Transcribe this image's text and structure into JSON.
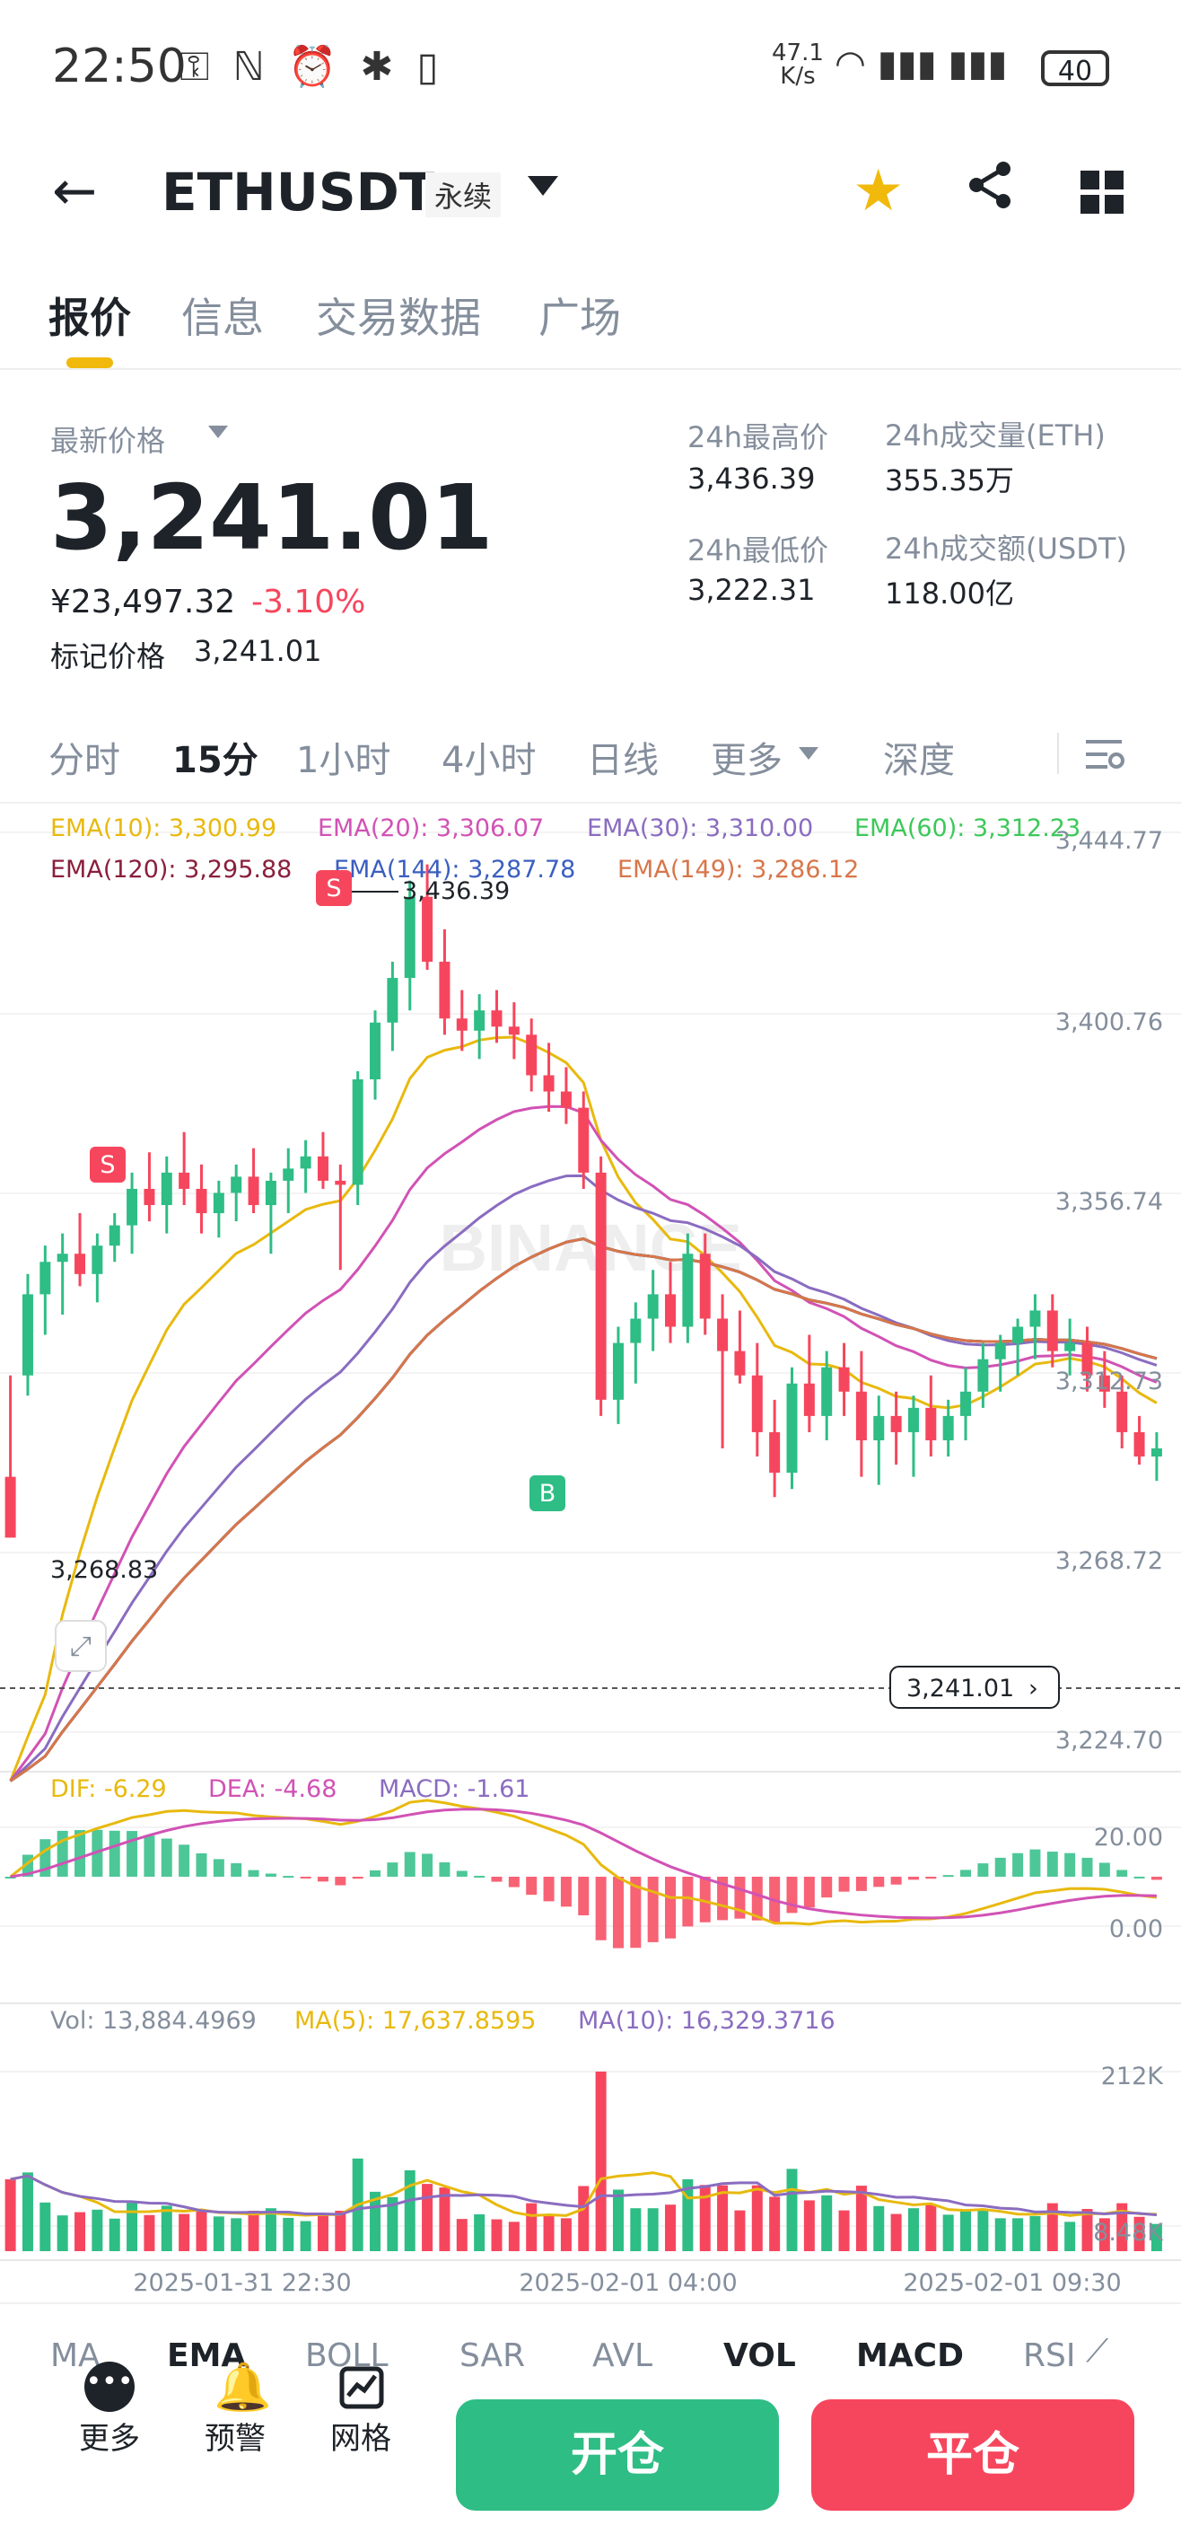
{
  "status_bar": {
    "time": "22:50",
    "icons_left": "⚿ ℕ ⏰ ✱ ▯",
    "net_rate_value": "47.1",
    "net_rate_unit": "K/s",
    "icons_right": "◠ ▮▮▮ ▮▮▮",
    "battery": "40"
  },
  "header": {
    "pair": "ETHUSDT",
    "contract_type": "永续"
  },
  "tabs": [
    "报价",
    "信息",
    "交易数据",
    "广场"
  ],
  "price": {
    "latest_label": "最新价格",
    "latest": "3,241.01",
    "cny": "¥23,497.32",
    "change": "-3.10%",
    "mark_label": "标记价格",
    "mark": "3,241.01"
  },
  "stats": {
    "high_label": "24h最高价",
    "high": "3,436.39",
    "low_label": "24h最低价",
    "low": "3,222.31",
    "vol_eth_label": "24h成交量(ETH)",
    "vol_eth": "355.35万",
    "vol_usdt_label": "24h成交额(USDT)",
    "vol_usdt": "118.00亿"
  },
  "intervals": [
    "分时",
    "15分",
    "1小时",
    "4小时",
    "日线",
    "更多",
    "深度"
  ],
  "ema_legend": {
    "ema10": "EMA(10): 3,300.99",
    "ema20": "EMA(20): 3,306.07",
    "ema30": "EMA(30): 3,310.00",
    "ema60": "EMA(60): 3,312.23",
    "ema120": "EMA(120): 3,295.88",
    "ema144": "EMA(144): 3,287.78",
    "ema149": "EMA(149): 3,286.12"
  },
  "price_axis": [
    "3,444.77",
    "3,400.76",
    "3,356.74",
    "3,312.73",
    "3,268.72",
    "3,224.70"
  ],
  "annotations": {
    "high_marker": "3,436.39",
    "low_marker": "3,268.83",
    "current_price_tag": "3,241.01",
    "sell_badge": "S",
    "buy_badge": "B"
  },
  "watermark": "BINANCE",
  "macd_legend": {
    "dif": "DIF: -6.29",
    "dea": "DEA: -4.68",
    "macd": "MACD: -1.61"
  },
  "macd_axis": [
    "20.00",
    "0.00"
  ],
  "vol_legend": {
    "vol": "Vol: 13,884.4969",
    "ma5": "MA(5): 17,637.8595",
    "ma10": "MA(10): 16,329.3716"
  },
  "vol_axis": [
    "212K",
    "8.48K"
  ],
  "time_axis": [
    "2025-01-31 22:30",
    "2025-02-01 04:00",
    "2025-02-01 09:30"
  ],
  "indicators": [
    "MA",
    "EMA",
    "BOLL",
    "SAR",
    "AVL",
    "VOL",
    "MACD",
    "RSI"
  ],
  "toolbar": {
    "more": "更多",
    "alert": "预警",
    "grid": "网格",
    "open": "开仓",
    "close": "平仓"
  },
  "colors": {
    "up": "#2ebd85",
    "down": "#f6465d",
    "accent": "#f0b90b",
    "ema10": "#e8b90e",
    "ema20": "#d152b5",
    "ema30": "#8a6cc0",
    "ema60": "#3cc85a",
    "ema120": "#8a1f3c",
    "ema144": "#3b5fc0",
    "ema149": "#d8764a"
  },
  "chart_data": {
    "type": "candlestick",
    "price_axis": {
      "min": 3224.7,
      "max": 3444.77,
      "ticks": [
        3444.77,
        3400.76,
        3356.74,
        3312.73,
        3268.72,
        3224.7
      ]
    },
    "candles": [
      [
        3285,
        3310,
        3278,
        3270
      ],
      [
        3310,
        3335,
        3305,
        3330
      ],
      [
        3330,
        3342,
        3320,
        3338
      ],
      [
        3338,
        3345,
        3325,
        3340
      ],
      [
        3340,
        3350,
        3332,
        3335
      ],
      [
        3335,
        3345,
        3328,
        3342
      ],
      [
        3342,
        3350,
        3338,
        3347
      ],
      [
        3347,
        3360,
        3340,
        3356
      ],
      [
        3356,
        3365,
        3348,
        3352
      ],
      [
        3352,
        3364,
        3345,
        3360
      ],
      [
        3360,
        3370,
        3352,
        3356
      ],
      [
        3356,
        3362,
        3345,
        3350
      ],
      [
        3350,
        3358,
        3344,
        3355
      ],
      [
        3355,
        3362,
        3348,
        3359
      ],
      [
        3359,
        3366,
        3350,
        3352
      ],
      [
        3352,
        3360,
        3340,
        3358
      ],
      [
        3358,
        3366,
        3350,
        3361
      ],
      [
        3361,
        3368,
        3355,
        3364
      ],
      [
        3364,
        3370,
        3356,
        3358
      ],
      [
        3358,
        3362,
        3336,
        3357
      ],
      [
        3357,
        3385,
        3352,
        3383
      ],
      [
        3383,
        3400,
        3378,
        3397
      ],
      [
        3397,
        3412,
        3390,
        3408
      ],
      [
        3408,
        3432,
        3400,
        3428
      ],
      [
        3428,
        3436,
        3410,
        3412
      ],
      [
        3412,
        3420,
        3394,
        3398
      ],
      [
        3398,
        3405,
        3390,
        3395
      ],
      [
        3395,
        3404,
        3388,
        3400
      ],
      [
        3400,
        3405,
        3392,
        3396
      ],
      [
        3396,
        3402,
        3388,
        3394
      ],
      [
        3394,
        3398,
        3380,
        3384
      ],
      [
        3384,
        3392,
        3375,
        3380
      ],
      [
        3380,
        3386,
        3372,
        3376
      ],
      [
        3376,
        3380,
        3356,
        3360
      ],
      [
        3360,
        3364,
        3300,
        3304
      ],
      [
        3304,
        3322,
        3298,
        3318
      ],
      [
        3318,
        3328,
        3308,
        3324
      ],
      [
        3324,
        3336,
        3316,
        3330
      ],
      [
        3330,
        3338,
        3318,
        3322
      ],
      [
        3322,
        3345,
        3318,
        3340
      ],
      [
        3340,
        3345,
        3320,
        3324
      ],
      [
        3324,
        3330,
        3292,
        3316
      ],
      [
        3316,
        3326,
        3308,
        3310
      ],
      [
        3310,
        3318,
        3290,
        3296
      ],
      [
        3296,
        3304,
        3280,
        3286
      ],
      [
        3286,
        3312,
        3282,
        3308
      ],
      [
        3308,
        3320,
        3296,
        3300
      ],
      [
        3300,
        3316,
        3294,
        3312
      ],
      [
        3312,
        3318,
        3300,
        3306
      ],
      [
        3306,
        3316,
        3285,
        3294
      ],
      [
        3294,
        3305,
        3283,
        3300
      ],
      [
        3300,
        3306,
        3288,
        3296
      ],
      [
        3296,
        3305,
        3285,
        3302
      ],
      [
        3302,
        3310,
        3290,
        3294
      ],
      [
        3294,
        3304,
        3290,
        3300
      ],
      [
        3300,
        3312,
        3294,
        3306
      ],
      [
        3306,
        3318,
        3302,
        3314
      ],
      [
        3314,
        3320,
        3306,
        3318
      ],
      [
        3318,
        3324,
        3310,
        3322
      ],
      [
        3322,
        3330,
        3314,
        3326
      ],
      [
        3326,
        3330,
        3312,
        3316
      ],
      [
        3316,
        3324,
        3310,
        3318
      ],
      [
        3318,
        3322,
        3306,
        3310
      ],
      [
        3310,
        3316,
        3302,
        3306
      ],
      [
        3306,
        3310,
        3292,
        3296
      ],
      [
        3296,
        3300,
        3288,
        3290
      ],
      [
        3290,
        3296,
        3284,
        3292
      ]
    ]
  }
}
